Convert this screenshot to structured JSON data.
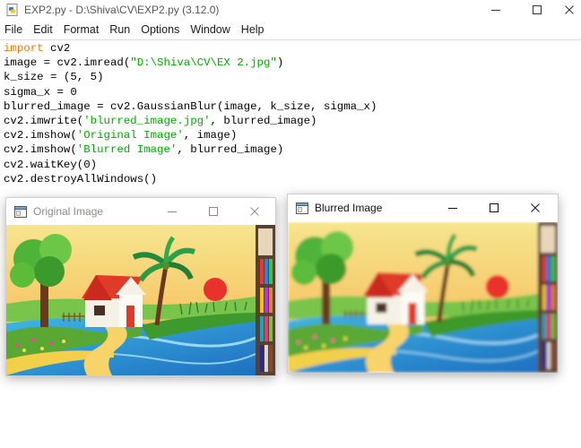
{
  "idle": {
    "title": "EXP2.py - D:\\Shiva\\CV\\EXP2.py (3.12.0)",
    "menu": [
      "File",
      "Edit",
      "Format",
      "Run",
      "Options",
      "Window",
      "Help"
    ],
    "code": [
      [
        {
          "t": "import",
          "c": "kw"
        },
        {
          "t": " cv2",
          "c": ""
        }
      ],
      [
        {
          "t": "image = cv2.imread(",
          "c": ""
        },
        {
          "t": "\"D:\\Shiva\\CV\\EX 2.jpg\"",
          "c": "str"
        },
        {
          "t": ")",
          "c": ""
        }
      ],
      [
        {
          "t": "k_size = (5, 5)",
          "c": ""
        }
      ],
      [
        {
          "t": "sigma_x = 0",
          "c": ""
        }
      ],
      [
        {
          "t": "blurred_image = cv2.GaussianBlur(image, k_size, sigma_x)",
          "c": ""
        }
      ],
      [
        {
          "t": "cv2.imwrite(",
          "c": ""
        },
        {
          "t": "'blurred_image.jpg'",
          "c": "str"
        },
        {
          "t": ", blurred_image)",
          "c": ""
        }
      ],
      [
        {
          "t": "cv2.imshow(",
          "c": ""
        },
        {
          "t": "'Original Image'",
          "c": "str"
        },
        {
          "t": ", image)",
          "c": ""
        }
      ],
      [
        {
          "t": "cv2.imshow(",
          "c": ""
        },
        {
          "t": "'Blurred Image'",
          "c": "str"
        },
        {
          "t": ", blurred_image)",
          "c": ""
        }
      ],
      [
        {
          "t": "cv2.waitKey(0)",
          "c": ""
        }
      ],
      [
        {
          "t": "cv2.destroyAllWindows()",
          "c": ""
        }
      ]
    ]
  },
  "original_window": {
    "title": "Original Image",
    "state": "inactive"
  },
  "blurred_window": {
    "title": "Blurred Image",
    "state": "active"
  },
  "colors": {
    "keyword": "#ff7700",
    "string": "#00aa00",
    "inactive_title": "#8a8a8a"
  },
  "icons": [
    "python-file-icon",
    "minimize-icon",
    "maximize-icon",
    "close-icon",
    "window-app-icon"
  ]
}
